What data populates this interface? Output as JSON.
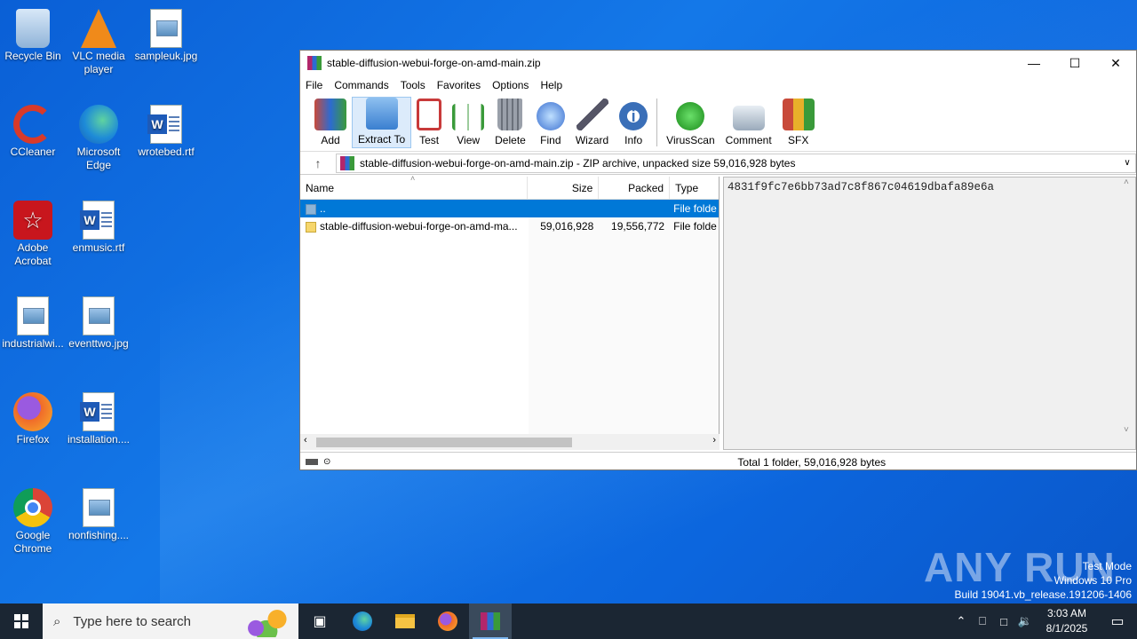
{
  "desktop": {
    "icons": [
      {
        "label": "Recycle Bin"
      },
      {
        "label": "VLC media player"
      },
      {
        "label": "sampleuk.jpg"
      },
      {
        "label": "CCleaner"
      },
      {
        "label": "Microsoft Edge"
      },
      {
        "label": "wrotebed.rtf"
      },
      {
        "label": "Adobe Acrobat"
      },
      {
        "label": "enmusic.rtf"
      },
      {
        "label": "industrialwi..."
      },
      {
        "label": "eventtwo.jpg"
      },
      {
        "label": "Firefox"
      },
      {
        "label": "installation...."
      },
      {
        "label": "Google Chrome"
      },
      {
        "label": "nonfishing...."
      }
    ]
  },
  "window": {
    "title": "stable-diffusion-webui-forge-on-amd-main.zip",
    "menu": [
      "File",
      "Commands",
      "Tools",
      "Favorites",
      "Options",
      "Help"
    ],
    "toolbar": [
      {
        "label": "Add",
        "icon": "add-archive-icon",
        "color": "#c84a3a"
      },
      {
        "label": "Extract To",
        "icon": "extract-folder-icon",
        "color": "#4a8fd8"
      },
      {
        "label": "Test",
        "icon": "test-clipboard-icon",
        "color": "#c83a3a"
      },
      {
        "label": "View",
        "icon": "view-book-icon",
        "color": "#3a9a3a"
      },
      {
        "label": "Delete",
        "icon": "trash-icon",
        "color": "#8a8f99"
      },
      {
        "label": "Find",
        "icon": "magnifier-icon",
        "color": "#3a6fd0"
      },
      {
        "label": "Wizard",
        "icon": "wand-icon",
        "color": "#6aa8d8"
      },
      {
        "label": "Info",
        "icon": "info-icon",
        "color": "#3a6fb8"
      },
      {
        "label": "VirusScan",
        "icon": "virus-scan-icon",
        "color": "#3aa83a"
      },
      {
        "label": "Comment",
        "icon": "comment-icon",
        "color": "#8a9aaa"
      },
      {
        "label": "SFX",
        "icon": "sfx-icon",
        "color": "#c86a3a"
      }
    ],
    "address": "stable-diffusion-webui-forge-on-amd-main.zip - ZIP archive, unpacked size 59,016,928 bytes",
    "columns": {
      "name": "Name",
      "size": "Size",
      "packed": "Packed",
      "type": "Type"
    },
    "rows": [
      {
        "name": "..",
        "size": "",
        "packed": "",
        "type": "File folde"
      },
      {
        "name": "stable-diffusion-webui-forge-on-amd-ma...",
        "size": "59,016,928",
        "packed": "19,556,772",
        "type": "File folde"
      }
    ],
    "preview_text": "4831f9fc7e6bb73ad7c8f867c04619dbafa89e6a",
    "status": "Total 1 folder, 59,016,928 bytes"
  },
  "taskbar": {
    "search_placeholder": "Type here to search",
    "time": "3:03 AM",
    "date": "8/1/2025"
  },
  "watermark": {
    "brand": "ANY RUN",
    "line1": "Test Mode",
    "line2": "Windows 10 Pro",
    "line3": "Build 19041.vb_release.191206-1406"
  }
}
